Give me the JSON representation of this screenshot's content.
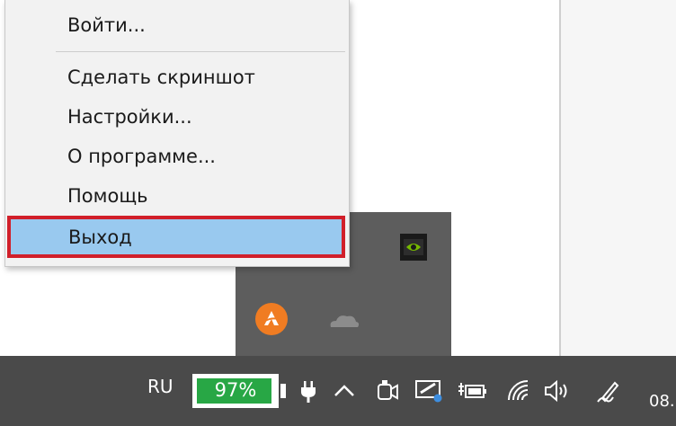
{
  "context_menu": {
    "items": [
      {
        "label": "Войти..."
      },
      {
        "label": "Сделать скриншот"
      },
      {
        "label": "Настройки..."
      },
      {
        "label": "О программе..."
      },
      {
        "label": "Помощь"
      },
      {
        "label": "Выход",
        "selected": true
      }
    ]
  },
  "tray_flyout": {
    "icons": [
      "nvidia-icon",
      "avast-icon",
      "cloud-icon"
    ]
  },
  "taskbar": {
    "language": "RU",
    "battery": {
      "percent_text": "97%",
      "level": 0.97
    },
    "icons": [
      "power-plug-icon",
      "chevron-up-icon",
      "camera-icon",
      "display-icon",
      "battery-charging-icon",
      "wifi-icon",
      "speaker-icon",
      "pen-icon"
    ],
    "time_partial": "08."
  },
  "colors": {
    "menu_bg": "#f2f2f2",
    "selection_bg": "#99c9ef",
    "highlight_border": "#d11f2a",
    "taskbar_bg": "#4a4a4a",
    "battery_fill": "#28a745",
    "avast_orange": "#f07c22"
  }
}
